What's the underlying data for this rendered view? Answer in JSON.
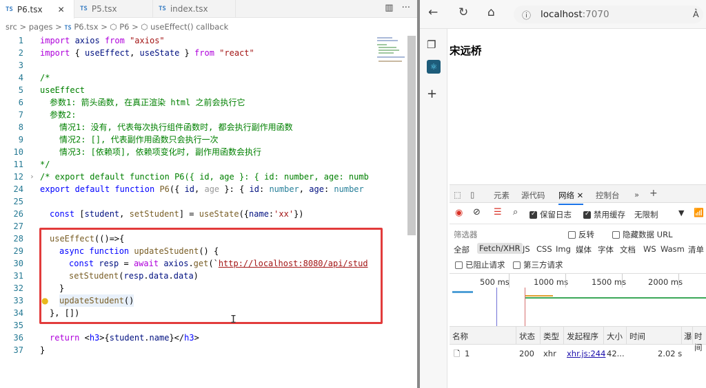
{
  "editor": {
    "tabs": [
      {
        "icon": "TS",
        "label": "P6.tsx",
        "close": "✕"
      },
      {
        "icon": "TS",
        "label": "P5.tsx"
      },
      {
        "icon": "TS",
        "label": "index.tsx"
      }
    ],
    "breadcrumb": {
      "p1": "src",
      "p2": "pages",
      "ts": "TS",
      "p3": "P6.tsx",
      "p4": "P6",
      "p5": "useEffect() callback"
    },
    "lines": [
      "1",
      "2",
      "3",
      "4",
      "5",
      "6",
      "7",
      "8",
      "9",
      "10",
      "11",
      "12",
      "24",
      "25",
      "26",
      "27",
      "28",
      "29",
      "30",
      "31",
      "32",
      "33",
      "34",
      "35",
      "36",
      "37"
    ]
  },
  "code": {
    "l1": [
      "import",
      " axios ",
      "from",
      " ",
      "\"axios\""
    ],
    "l2": [
      "import",
      " { ",
      "useEffect",
      ", ",
      "useState",
      " } ",
      "from",
      " ",
      "\"react\""
    ],
    "l4": "/*",
    "l5": "useEffect",
    "l6": "参数1: 箭头函数, 在真正渲染 html 之前会执行它",
    "l7": "参数2:",
    "l8": "情况1: 没有, 代表每次执行组件函数时, 都会执行副作用函数",
    "l9": "情况2: [], 代表副作用函数只会执行一次",
    "l10": "情况3: [依赖项], 依赖项变化时, 副作用函数会执行",
    "l11": "*/",
    "l12": "/* export default function P6({ id, age }: { id: number, age: numb",
    "l24": [
      "export",
      " ",
      "default",
      " ",
      "function",
      " ",
      "P6",
      "({ ",
      "id",
      ", ",
      "age",
      " }: { ",
      "id",
      ": ",
      "number",
      ", ",
      "age",
      ": ",
      "number"
    ],
    "l26": [
      "const",
      " [",
      "student",
      ", ",
      "setStudent",
      "] = ",
      "useState",
      "({",
      "name",
      ":",
      "'xx'",
      "})"
    ],
    "l28": [
      "useEffect",
      "(()=>{"
    ],
    "l29": [
      "async",
      " ",
      "function",
      " ",
      "updateStudent",
      "() {"
    ],
    "l30": [
      "const",
      " ",
      "resp",
      " = ",
      "await",
      " ",
      "axios",
      ".",
      "get",
      "(`",
      "http://localhost:8080/api/stud"
    ],
    "l31": [
      "setStudent",
      "(",
      "resp",
      ".",
      "data",
      ".",
      "data",
      ")"
    ],
    "l32": "}",
    "l33": [
      "updateStudent",
      "()"
    ],
    "l34": "}, [])",
    "l36": [
      "return",
      " <",
      "h3",
      ">{",
      "student",
      ".",
      "name",
      "}</",
      "h3",
      ">"
    ],
    "l37": "}"
  },
  "browser": {
    "url_host": "localhost",
    "url_port": ":7070",
    "page_h3": "宋远桥",
    "devtools": {
      "tabs": [
        "元素",
        "源代码",
        "网络",
        "控制台",
        "»",
        "+"
      ],
      "toolbar": {
        "preserve_log": "保留日志",
        "disable_cache": "禁用缓存",
        "throttle": "无限制"
      },
      "filter_placeholder": "筛选器",
      "invert": "反转",
      "hide_data_urls": "隐藏数据 URL",
      "type_filters": [
        "全部",
        "Fetch/XHR",
        "JS",
        "CSS",
        "Img",
        "媒体",
        "字体",
        "文档",
        "WS",
        "Wasm",
        "清单"
      ],
      "blocked_requests": "已阻止请求",
      "third_party": "第三方请求",
      "timeline_ticks": [
        "500 ms",
        "1000 ms",
        "1500 ms",
        "2000 ms"
      ],
      "columns": [
        "名称",
        "状态",
        "类型",
        "发起程序",
        "大小",
        "时间",
        "瀑",
        "时间"
      ],
      "rows": [
        {
          "name": "1",
          "status": "200",
          "type": "xhr",
          "initiator": "xhr.js:244",
          "size": "42...",
          "time": "2.02 s"
        }
      ]
    }
  }
}
